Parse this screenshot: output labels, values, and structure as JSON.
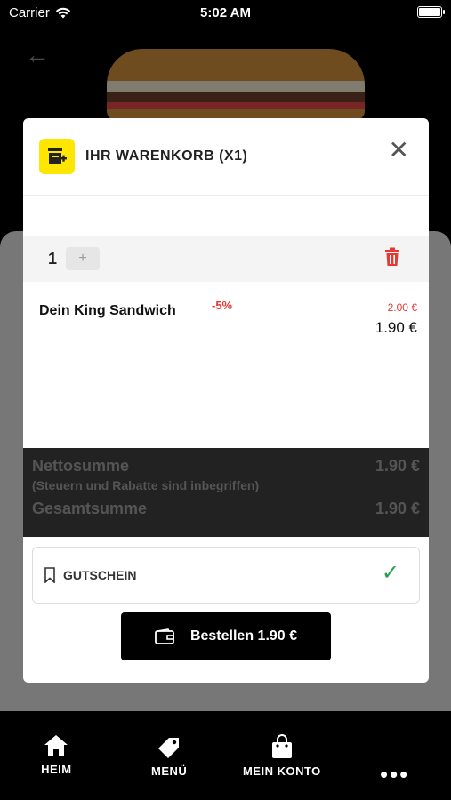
{
  "status_bar": {
    "carrier": "Carrier",
    "time": "5:02 AM"
  },
  "cart": {
    "title": "IHR WARENKORB (X1)",
    "quantity": "1",
    "plus": "+",
    "item": {
      "name": "Dein King Sandwich",
      "discount": "-5%",
      "old_price": "2.00 €",
      "price": "1.90 €"
    },
    "totals": {
      "net_label": "Nettosumme",
      "net_value": "1.90 €",
      "note": "(Steuern und Rabatte sind inbegriffen)",
      "total_label": "Gesamtsumme",
      "total_value": "1.90 €"
    },
    "voucher_label": "GUTSCHEIN",
    "order_button": "Bestellen 1.90 €"
  },
  "nav": {
    "items": [
      {
        "label": "HEIM",
        "icon": "home-icon"
      },
      {
        "label": "MENÜ",
        "icon": "tag-icon"
      },
      {
        "label": "MEIN KONTO",
        "icon": "shopping-bag-icon"
      },
      {
        "label": "",
        "icon": "more-icon"
      }
    ]
  },
  "colors": {
    "accent": "#ffe600",
    "danger": "#e53935",
    "success": "#2e9c4f"
  }
}
